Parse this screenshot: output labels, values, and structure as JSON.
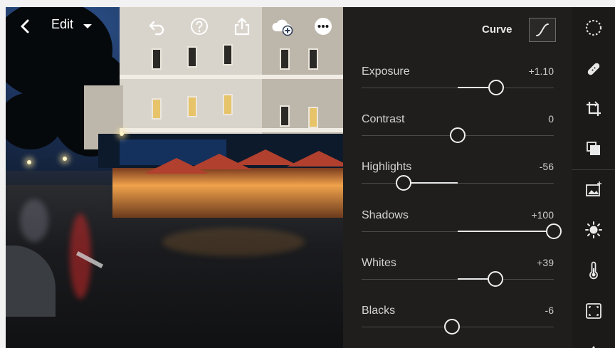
{
  "toolbar": {
    "back_icon": "chevron-left-icon",
    "edit_label": "Edit",
    "dropdown_icon": "caret-down-icon",
    "undo_icon": "undo-icon",
    "help_icon": "help-icon",
    "share_icon": "share-icon",
    "cloud_icon": "cloud-add-icon",
    "more_icon": "more-icon"
  },
  "panel": {
    "title": "Curve",
    "curve_icon": "curve-icon",
    "sliders": [
      {
        "label": "Exposure",
        "value": "+1.10",
        "level": 0.7
      },
      {
        "label": "Contrast",
        "value": "0",
        "level": 0.5
      },
      {
        "label": "Highlights",
        "value": "-56",
        "level": 0.22
      },
      {
        "label": "Shadows",
        "value": "+100",
        "level": 1.0
      },
      {
        "label": "Whites",
        "value": "+39",
        "level": 0.695
      },
      {
        "label": "Blacks",
        "value": "-6",
        "level": 0.47
      }
    ]
  },
  "rail": {
    "icons": [
      "selective-icon",
      "heal-icon",
      "crop-icon",
      "presets-icon",
      "auto-icon",
      "light-icon",
      "color-icon",
      "effects-icon"
    ]
  },
  "colors": {
    "panel_bg": "#1f1e1d",
    "rail_bg": "#1b1a19",
    "slider_fill": "#e8e8e8",
    "accent_white": "#ffffff"
  }
}
